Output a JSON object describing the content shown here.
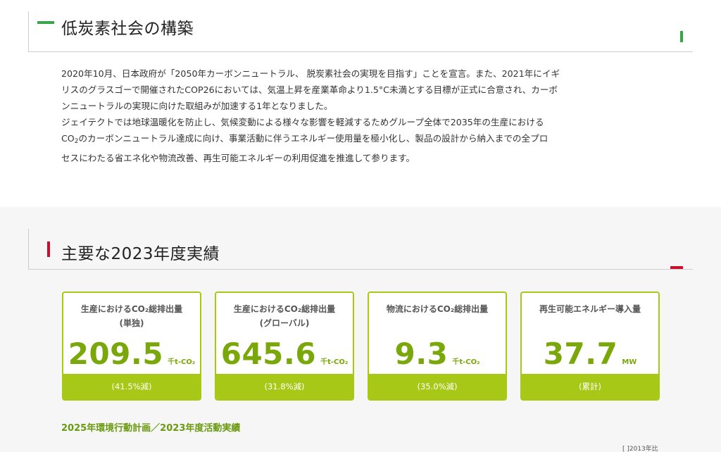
{
  "section1": {
    "title": "低炭素社会の構築",
    "para1": [
      "2020年10月、日本政府が「2050年カーボンニュートラル、 脱炭素社会の実現を目指す」ことを宣言。また、2021年にイギ",
      "リスのグラスゴーで開催されたCOP26においては、気温上昇を産業革命より1.5°C未満とする目標が正式に合意され、カーボ",
      "ンニュートラルの実現に向けた取組みが加速する1年となりました。"
    ],
    "para2": [
      "ジェイテクトでは地球温暖化を防止し、気候変動による様々な影響を軽減するためグループ全体で2035年の生産における",
      "のカーボンニュートラル達成に向け、事業活動に伴うエネルギー使用量を極小化し、製品の設計から納入までの全プロ",
      "セスにわたる省エネ化や物流改善、再生可能エネルギーの利用促進を推進して参ります。"
    ],
    "co2_prefix": "CO",
    "co2_sub": "2"
  },
  "section2": {
    "title": "主要な2023年度実績",
    "cards": [
      {
        "title1": "生産におけるCO₂総排出量",
        "title2": "(単独)",
        "value": "209.5",
        "unit": "千t-CO₂",
        "footer": "(41.5%減)"
      },
      {
        "title1": "生産におけるCO₂総排出量",
        "title2": "(グローバル)",
        "value": "645.6",
        "unit": "千t-CO₂",
        "footer": "(31.8%減)"
      },
      {
        "title1": "物流におけるCO₂総排出量",
        "title2": "",
        "value": "9.3",
        "unit": "千t-CO₂",
        "footer": "(35.0%減)"
      },
      {
        "title1": "再生可能エネルギー導入量",
        "title2": "",
        "value": "37.7",
        "unit": "MW",
        "footer": "(累計)"
      }
    ],
    "subheading": "2025年環境行動計画／2023年度活動実績",
    "note": "[ ]2013年比"
  }
}
